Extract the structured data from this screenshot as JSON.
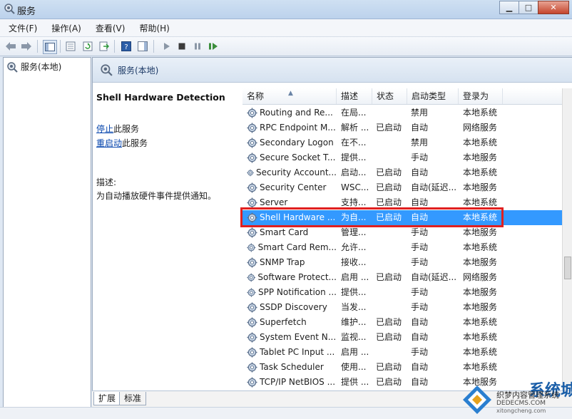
{
  "window": {
    "title": "服务"
  },
  "menu": [
    "文件(F)",
    "操作(A)",
    "查看(V)",
    "帮助(H)"
  ],
  "tree": {
    "root_label": "服务(本地)"
  },
  "pane": {
    "header": "服务(本地)"
  },
  "details": {
    "service_name": "Shell Hardware Detection",
    "stop_link": "停止",
    "stop_suffix": "此服务",
    "restart_link": "重启动",
    "restart_suffix": "此服务",
    "desc_label": "描述:",
    "desc_text": "为自动播放硬件事件提供通知。"
  },
  "columns": [
    "名称",
    "描述",
    "状态",
    "启动类型",
    "登录为"
  ],
  "rows": [
    {
      "name": "Routing and Re...",
      "desc": "在局...",
      "state": "",
      "start": "禁用",
      "logon": "本地系统"
    },
    {
      "name": "RPC Endpoint M...",
      "desc": "解析 ...",
      "state": "已启动",
      "start": "自动",
      "logon": "网络服务"
    },
    {
      "name": "Secondary Logon",
      "desc": "在不...",
      "state": "",
      "start": "禁用",
      "logon": "本地系统"
    },
    {
      "name": "Secure Socket T...",
      "desc": "提供...",
      "state": "",
      "start": "手动",
      "logon": "本地服务"
    },
    {
      "name": "Security Account...",
      "desc": "启动...",
      "state": "已启动",
      "start": "自动",
      "logon": "本地系统"
    },
    {
      "name": "Security Center",
      "desc": "WSC...",
      "state": "已启动",
      "start": "自动(延迟...",
      "logon": "本地服务"
    },
    {
      "name": "Server",
      "desc": "支持...",
      "state": "已启动",
      "start": "自动",
      "logon": "本地系统"
    },
    {
      "name": "Shell Hardware ...",
      "desc": "为自...",
      "state": "已启动",
      "start": "自动",
      "logon": "本地系统"
    },
    {
      "name": "Smart Card",
      "desc": "管理...",
      "state": "",
      "start": "手动",
      "logon": "本地服务"
    },
    {
      "name": "Smart Card Rem...",
      "desc": "允许...",
      "state": "",
      "start": "手动",
      "logon": "本地系统"
    },
    {
      "name": "SNMP Trap",
      "desc": "接收...",
      "state": "",
      "start": "手动",
      "logon": "本地服务"
    },
    {
      "name": "Software Protect...",
      "desc": "启用 ...",
      "state": "已启动",
      "start": "自动(延迟...",
      "logon": "网络服务"
    },
    {
      "name": "SPP Notification ...",
      "desc": "提供...",
      "state": "",
      "start": "手动",
      "logon": "本地服务"
    },
    {
      "name": "SSDP Discovery",
      "desc": "当发...",
      "state": "",
      "start": "手动",
      "logon": "本地服务"
    },
    {
      "name": "Superfetch",
      "desc": "维护...",
      "state": "已启动",
      "start": "自动",
      "logon": "本地系统"
    },
    {
      "name": "System Event N...",
      "desc": "监视...",
      "state": "已启动",
      "start": "自动",
      "logon": "本地系统"
    },
    {
      "name": "Tablet PC Input ...",
      "desc": "启用 ...",
      "state": "",
      "start": "手动",
      "logon": "本地系统"
    },
    {
      "name": "Task Scheduler",
      "desc": "使用...",
      "state": "已启动",
      "start": "自动",
      "logon": "本地系统"
    },
    {
      "name": "TCP/IP NetBIOS ...",
      "desc": "提供 ...",
      "state": "已启动",
      "start": "自动",
      "logon": "本地服务"
    }
  ],
  "selected_index": 7,
  "tabs": [
    "扩展",
    "标准"
  ],
  "watermark": {
    "brand": "系统城",
    "line1": "织梦内容管理系统",
    "line2": "DEDECMS.COM",
    "line3": "xitongcheng.com"
  },
  "colors": {
    "selection": "#3399ff",
    "highlight_box": "#e02020",
    "link": "#0645ad"
  }
}
